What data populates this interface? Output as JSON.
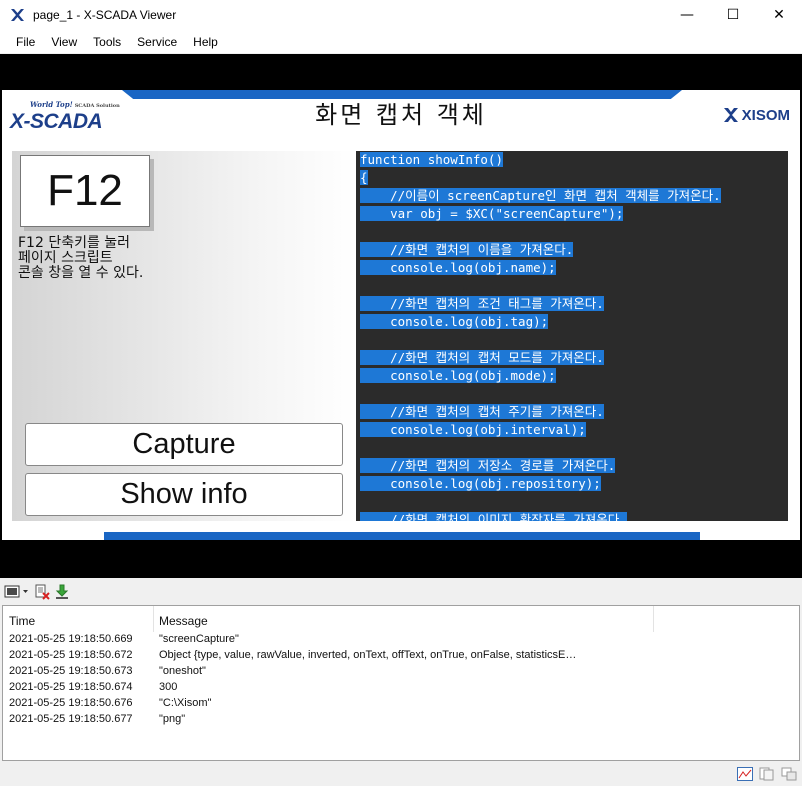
{
  "window": {
    "title": "page_1 - X-SCADA Viewer",
    "minimize": "—",
    "maximize": "☐",
    "close": "✕"
  },
  "menu": [
    "File",
    "View",
    "Tools",
    "Service",
    "Help"
  ],
  "header": {
    "logo_tagline": "World Top!",
    "logo_subtag": "SCADA Solution",
    "logo_word": "X-SCADA",
    "title": "화면 캡처 객체",
    "brand": "XISOM"
  },
  "left": {
    "key_label": "F12",
    "key_description": "F12 단축키를 눌러\n페이지 스크립트\n콘솔 창을 열 수 있다.",
    "capture_button": "Capture",
    "showinfo_button": "Show info"
  },
  "code": [
    {
      "indent": "",
      "text": "function showInfo()"
    },
    {
      "indent": "",
      "text": "{"
    },
    {
      "indent": "    ",
      "text": "//이름이 screenCapture인 화면 캡처 객체를 가져온다."
    },
    {
      "indent": "    ",
      "text": "var obj = $XC(\"screenCapture\");"
    },
    {
      "indent": "",
      "text": ""
    },
    {
      "indent": "    ",
      "text": "//화면 캡처의 이름을 가져온다."
    },
    {
      "indent": "    ",
      "text": "console.log(obj.name);"
    },
    {
      "indent": "",
      "text": ""
    },
    {
      "indent": "    ",
      "text": "//화면 캡처의 조건 태그를 가져온다."
    },
    {
      "indent": "    ",
      "text": "console.log(obj.tag);"
    },
    {
      "indent": "",
      "text": ""
    },
    {
      "indent": "    ",
      "text": "//화면 캡처의 캡처 모드를 가져온다."
    },
    {
      "indent": "    ",
      "text": "console.log(obj.mode);"
    },
    {
      "indent": "",
      "text": ""
    },
    {
      "indent": "    ",
      "text": "//화면 캡처의 캡처 주기를 가져온다."
    },
    {
      "indent": "    ",
      "text": "console.log(obj.interval);"
    },
    {
      "indent": "",
      "text": ""
    },
    {
      "indent": "    ",
      "text": "//화면 캡처의 저장소 경로를 가져온다."
    },
    {
      "indent": "    ",
      "text": "console.log(obj.repository);"
    },
    {
      "indent": "",
      "text": ""
    },
    {
      "indent": "    ",
      "text": "//화면 캡처의 이미지 확장자를 가져온다."
    }
  ],
  "console": {
    "col_time": "Time",
    "col_message": "Message",
    "rows": [
      {
        "time": "2021-05-25 19:18:50.669",
        "message": "\"screenCapture\""
      },
      {
        "time": "2021-05-25 19:18:50.672",
        "message": "Object {type, value, rawValue, inverted, onText, offText, onTrue, onFalse, statisticsE…"
      },
      {
        "time": "2021-05-25 19:18:50.673",
        "message": "\"oneshot\""
      },
      {
        "time": "2021-05-25 19:18:50.674",
        "message": "300"
      },
      {
        "time": "2021-05-25 19:18:50.676",
        "message": "\"C:\\Xisom\""
      },
      {
        "time": "2021-05-25 19:18:50.677",
        "message": "\"png\""
      }
    ]
  },
  "colors": {
    "accent": "#1a66c4",
    "selection": "#1e78d6",
    "code_bg": "#2b2b2b"
  }
}
